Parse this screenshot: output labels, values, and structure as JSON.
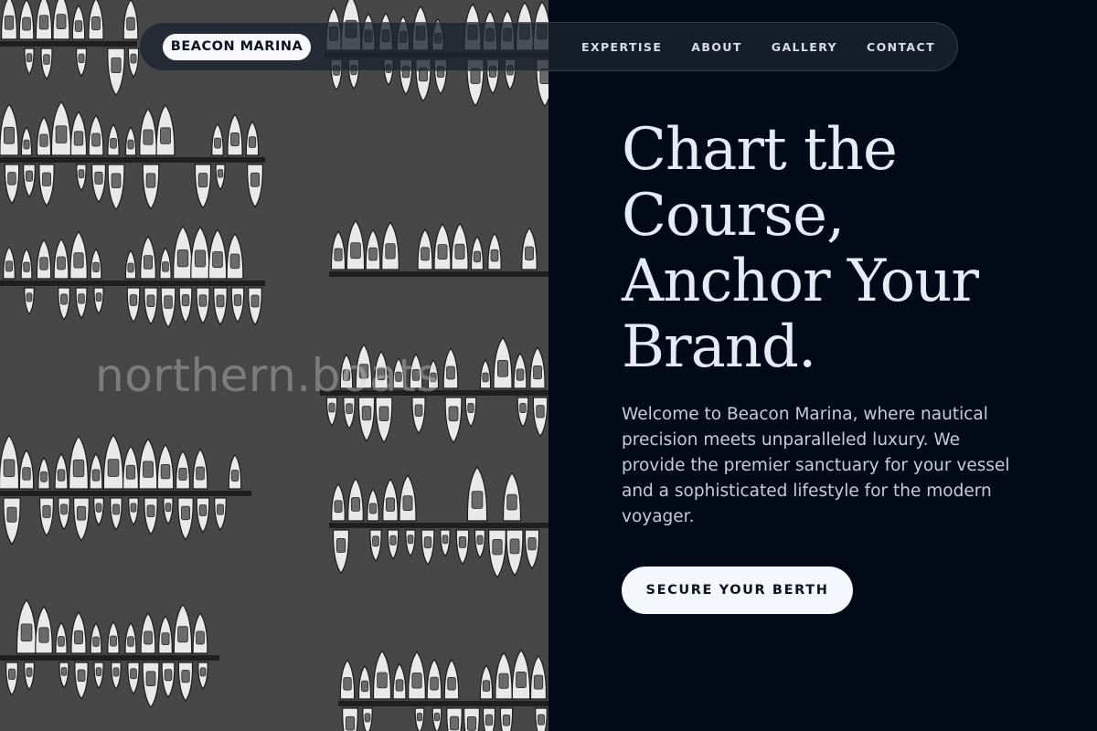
{
  "brand": {
    "logo_text": "BEACON MARINA"
  },
  "nav": {
    "links": [
      "EXPERTISE",
      "ABOUT",
      "GALLERY",
      "CONTACT"
    ]
  },
  "photo": {
    "watermark": "northern.boats"
  },
  "hero": {
    "title_lines": [
      "Chart the",
      "Course,",
      "Anchor Your",
      "Brand."
    ],
    "body": "Welcome to Beacon Marina, where nautical precision meets unparalleled luxury. We provide the premier sanctuary for your vessel and a sophisticated lifestyle for the modern voyager.",
    "cta_label": "SECURE YOUR BERTH"
  },
  "colors": {
    "hero_background": "#010a16",
    "photo_water": "#474747",
    "title_text": "#e4ebf5",
    "body_text": "#c4cdd8",
    "button_background": "#f4f7fb",
    "button_text": "#0c1420"
  }
}
